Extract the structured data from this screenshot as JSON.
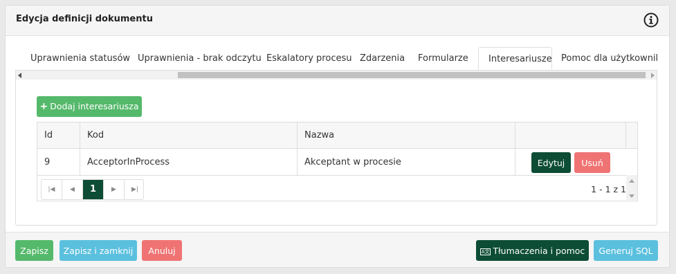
{
  "header": {
    "title": "Edycja definicji dokumentu",
    "info_icon": "info-circle-icon"
  },
  "tabs": [
    {
      "label": "Uprawnienia statusów",
      "active": false
    },
    {
      "label": "Uprawnienia - brak odczytu",
      "active": false
    },
    {
      "label": "Eskalatory procesu",
      "active": false
    },
    {
      "label": "Zdarzenia",
      "active": false
    },
    {
      "label": "Formularze",
      "active": false
    },
    {
      "label": "Interesariusze",
      "active": true
    },
    {
      "label": "Pomoc dla użytkownika",
      "active": false
    }
  ],
  "toolbar": {
    "add_label": "Dodaj interesariusza",
    "add_icon": "plus-icon"
  },
  "grid": {
    "columns": [
      "Id",
      "Kod",
      "Nazwa",
      ""
    ],
    "rows": [
      {
        "id": "9",
        "kod": "AcceptorInProcess",
        "nazwa": "Akceptant w procesie",
        "edit_label": "Edytuj",
        "delete_label": "Usuń"
      }
    ]
  },
  "pager": {
    "first_icon": "first-page-icon",
    "prev_icon": "prev-page-icon",
    "current_page": "1",
    "next_icon": "next-page-icon",
    "last_icon": "last-page-icon",
    "info": "1 - 1 z 1"
  },
  "footer": {
    "save": "Zapisz",
    "save_close": "Zapisz i zamknij",
    "cancel": "Anuluj",
    "translations": "Tłumaczenia i pomoc",
    "translations_icon_text": "A文",
    "generate_sql": "Generuj SQL"
  },
  "colors": {
    "green": "#55b96b",
    "dark_green": "#0d4d35",
    "red": "#f07373",
    "cyan": "#5bc0de"
  }
}
